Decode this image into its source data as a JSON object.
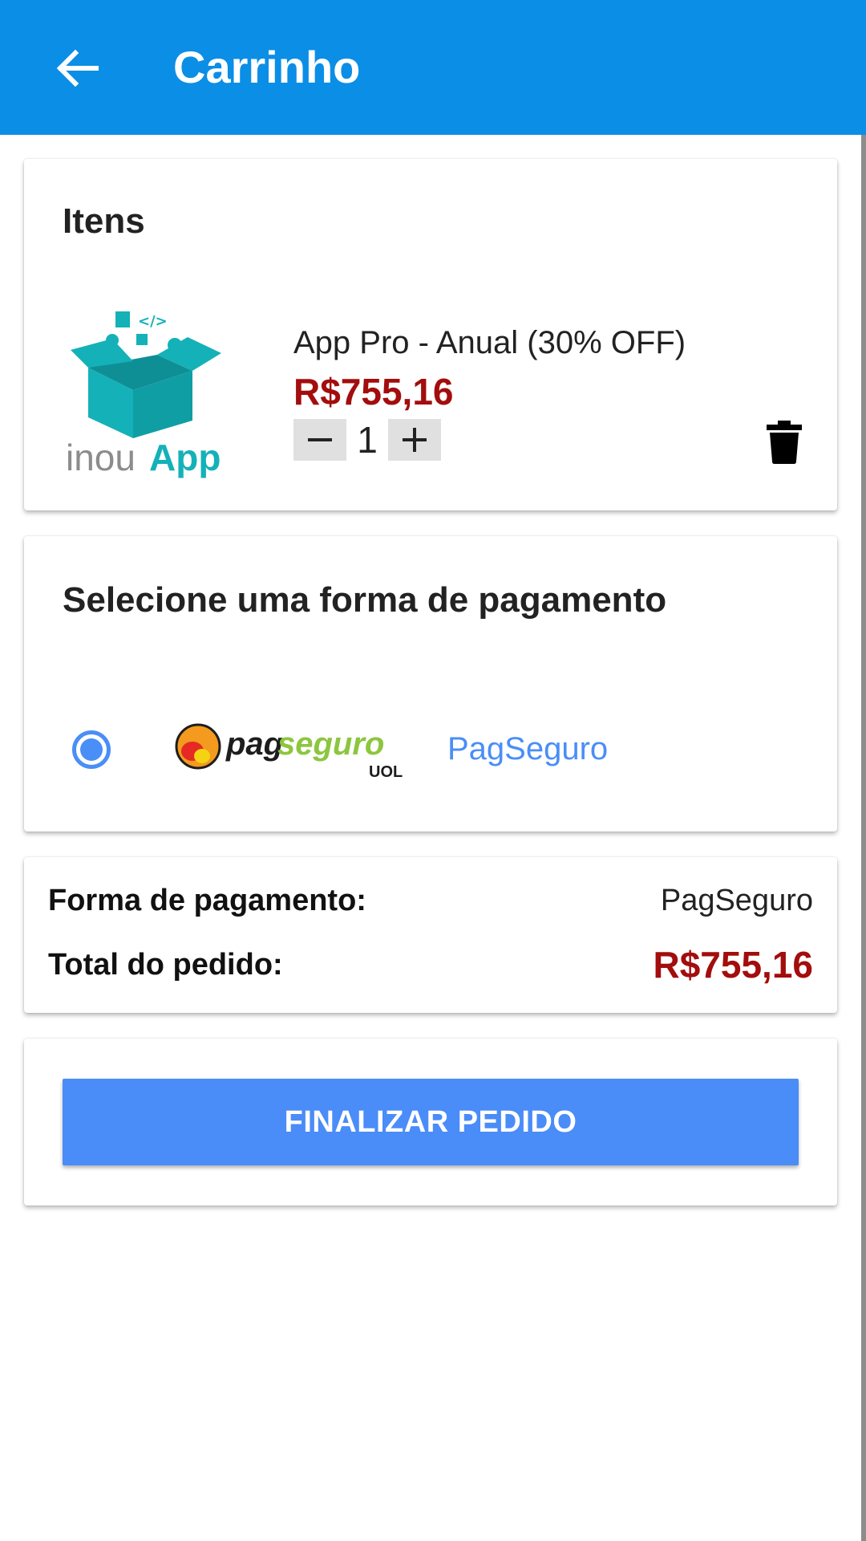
{
  "header": {
    "title": "Carrinho",
    "back_icon": "arrow-left-icon",
    "background_color": "#0b8ee6"
  },
  "items_section": {
    "title": "Itens",
    "items": [
      {
        "logo_text": "inouApp",
        "logo_color": "#14b1b8",
        "name": "App Pro - Anual (30% OFF)",
        "price": "R$755,16",
        "quantity": "1",
        "decrement_icon": "minus-icon",
        "increment_icon": "plus-icon",
        "delete_icon": "trash-icon"
      }
    ]
  },
  "payment_section": {
    "title": "Selecione uma forma de pagamento",
    "options": [
      {
        "logo_text_pag": "pag",
        "logo_text_seguro": "seguro",
        "logo_text_uol": "UOL",
        "name": "PagSeguro",
        "selected": true
      }
    ]
  },
  "summary": {
    "payment_label": "Forma de pagamento:",
    "payment_value": "PagSeguro",
    "total_label": "Total do pedido:",
    "total_value": "R$755,16"
  },
  "actions": {
    "finalize_label": "FINALIZAR PEDIDO"
  },
  "colors": {
    "accent": "#4a8cf8",
    "price": "#a30d0d"
  }
}
